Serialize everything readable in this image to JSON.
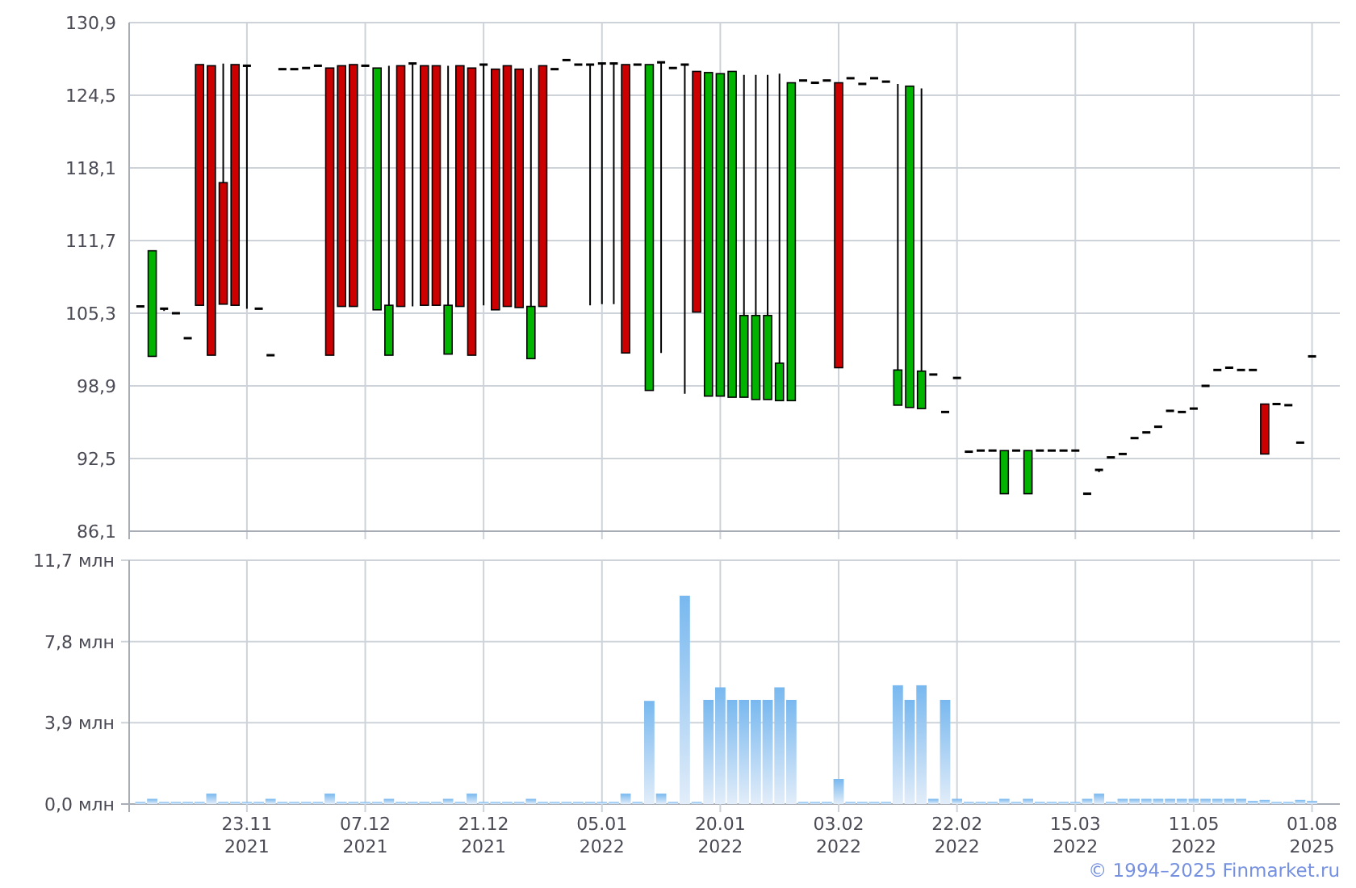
{
  "price_chart": {
    "chart_data": {
      "type": "candlestick",
      "grid": true,
      "categories": [
        null,
        null,
        null,
        null,
        null,
        null,
        null,
        null,
        null,
        null,
        null,
        null,
        null,
        null,
        null,
        null,
        null,
        null,
        null,
        null,
        null,
        null,
        null,
        null,
        null,
        null,
        null,
        null,
        null,
        null,
        null,
        null,
        null,
        null,
        null,
        null,
        null,
        null,
        null,
        null,
        null,
        null,
        null,
        null,
        null,
        null,
        null,
        null,
        null,
        null,
        null,
        null,
        null,
        null,
        null,
        null,
        null,
        null,
        null,
        null,
        null,
        null,
        null,
        null,
        null,
        null,
        null,
        null,
        null,
        null,
        null,
        null,
        null,
        null,
        null,
        null,
        null,
        null,
        null,
        null,
        null,
        null,
        null,
        null,
        null,
        null,
        null,
        null,
        null,
        null,
        null,
        null,
        null,
        null,
        null,
        null,
        null,
        null,
        null,
        null
      ],
      "ylim": [
        86.1,
        130.9
      ],
      "yticks": [
        {
          "value": 86.1,
          "label": "86,1"
        },
        {
          "value": 92.5,
          "label": "92,5"
        },
        {
          "value": 98.9,
          "label": "98,9"
        },
        {
          "value": 105.3,
          "label": "105,3"
        },
        {
          "value": 111.7,
          "label": "111,7"
        },
        {
          "value": 118.1,
          "label": "118,1"
        },
        {
          "value": 124.5,
          "label": "124,5"
        },
        {
          "value": 130.9,
          "label": "130,9"
        }
      ],
      "ohlc": [
        [
          105.9,
          105.9,
          105.9,
          105.9
        ],
        [
          101.5,
          110.8,
          101.5,
          110.8
        ],
        [
          105.5,
          105.7,
          105.5,
          105.7
        ],
        [
          105.3,
          105.3,
          105.3,
          105.3
        ],
        [
          103.1,
          103.1,
          103.1,
          103.1
        ],
        [
          127.2,
          127.2,
          106.0,
          106.0
        ],
        [
          127.1,
          127.1,
          101.6,
          101.6
        ],
        [
          116.8,
          127.3,
          106.1,
          106.1
        ],
        [
          127.2,
          127.2,
          106.0,
          106.0
        ],
        [
          127.1,
          127.1,
          105.7,
          127.1
        ],
        [
          105.7,
          105.7,
          105.7,
          105.7
        ],
        [
          101.6,
          101.6,
          101.6,
          101.6
        ],
        [
          126.8,
          126.8,
          126.8,
          126.8
        ],
        [
          126.8,
          126.8,
          126.8,
          126.8
        ],
        [
          126.9,
          126.9,
          126.9,
          126.9
        ],
        [
          127.1,
          127.1,
          127.1,
          127.1
        ],
        [
          126.9,
          126.9,
          101.6,
          101.6
        ],
        [
          127.1,
          127.1,
          105.9,
          105.9
        ],
        [
          127.2,
          127.2,
          105.9,
          105.9
        ],
        [
          127.1,
          127.1,
          127.1,
          127.1
        ],
        [
          105.6,
          126.9,
          105.6,
          126.9
        ],
        [
          101.6,
          127.1,
          101.6,
          106.0
        ],
        [
          127.1,
          127.1,
          105.9,
          105.9
        ],
        [
          127.3,
          127.3,
          105.9,
          127.3
        ],
        [
          127.1,
          127.1,
          106.0,
          106.0
        ],
        [
          127.1,
          127.1,
          106.0,
          106.0
        ],
        [
          101.7,
          127.1,
          101.7,
          106.0
        ],
        [
          127.1,
          127.1,
          105.9,
          105.9
        ],
        [
          126.9,
          126.9,
          101.6,
          101.6
        ],
        [
          127.2,
          127.2,
          106.0,
          127.2
        ],
        [
          126.8,
          126.8,
          105.6,
          105.6
        ],
        [
          127.1,
          127.1,
          105.9,
          105.9
        ],
        [
          126.8,
          126.8,
          105.8,
          105.8
        ],
        [
          101.3,
          126.9,
          101.3,
          105.9
        ],
        [
          127.1,
          127.1,
          105.9,
          105.9
        ],
        [
          126.8,
          126.8,
          126.8,
          126.8
        ],
        [
          127.6,
          127.6,
          127.6,
          127.6
        ],
        [
          127.2,
          127.2,
          127.2,
          127.2
        ],
        [
          127.2,
          127.2,
          106.0,
          127.2
        ],
        [
          127.3,
          127.3,
          106.1,
          127.3
        ],
        [
          127.3,
          127.3,
          106.1,
          127.3
        ],
        [
          127.2,
          127.2,
          101.8,
          101.8
        ],
        [
          127.2,
          127.2,
          127.2,
          127.2
        ],
        [
          98.5,
          127.2,
          98.5,
          127.2
        ],
        [
          127.4,
          127.4,
          101.8,
          127.4
        ],
        [
          126.9,
          126.9,
          126.9,
          126.9
        ],
        [
          127.0,
          127.2,
          98.2,
          127.2
        ],
        [
          126.6,
          126.6,
          105.4,
          105.4
        ],
        [
          98.0,
          126.5,
          98.0,
          126.5
        ],
        [
          98.0,
          126.4,
          98.0,
          126.4
        ],
        [
          97.9,
          126.6,
          97.9,
          126.6
        ],
        [
          97.9,
          126.3,
          97.9,
          105.1
        ],
        [
          97.7,
          126.3,
          97.7,
          105.1
        ],
        [
          97.7,
          126.3,
          97.7,
          105.1
        ],
        [
          97.6,
          126.4,
          97.6,
          100.9
        ],
        [
          97.6,
          125.6,
          97.6,
          125.6
        ],
        [
          125.8,
          125.8,
          125.8,
          125.8
        ],
        [
          125.6,
          125.6,
          125.6,
          125.6
        ],
        [
          125.8,
          125.8,
          125.8,
          125.8
        ],
        [
          125.6,
          125.6,
          100.5,
          100.5
        ],
        [
          126.0,
          126.0,
          126.0,
          126.0
        ],
        [
          125.5,
          125.5,
          125.5,
          125.5
        ],
        [
          126.0,
          126.0,
          126.0,
          126.0
        ],
        [
          125.7,
          125.7,
          125.7,
          125.7
        ],
        [
          97.2,
          125.5,
          97.2,
          100.3
        ],
        [
          97.0,
          125.3,
          97.0,
          125.3
        ],
        [
          96.9,
          125.1,
          96.9,
          100.2
        ],
        [
          99.9,
          99.9,
          99.9,
          99.9
        ],
        [
          96.6,
          96.6,
          96.6,
          96.6
        ],
        [
          99.6,
          99.6,
          99.6,
          99.6
        ],
        [
          93.1,
          93.1,
          93.1,
          93.1
        ],
        [
          93.2,
          93.2,
          93.2,
          93.2
        ],
        [
          93.2,
          93.2,
          93.2,
          93.2
        ],
        [
          89.4,
          93.2,
          89.4,
          93.2
        ],
        [
          93.2,
          93.2,
          93.2,
          93.2
        ],
        [
          89.4,
          93.2,
          89.4,
          93.2
        ],
        [
          93.2,
          93.2,
          93.2,
          93.2
        ],
        [
          93.2,
          93.2,
          93.2,
          93.2
        ],
        [
          93.2,
          93.2,
          93.2,
          93.2
        ],
        [
          93.2,
          93.2,
          93.2,
          93.2
        ],
        [
          89.4,
          89.4,
          89.4,
          89.4
        ],
        [
          91.3,
          91.5,
          91.3,
          91.5
        ],
        [
          92.6,
          92.6,
          92.6,
          92.6
        ],
        [
          92.9,
          92.9,
          92.9,
          92.9
        ],
        [
          94.3,
          94.3,
          94.3,
          94.3
        ],
        [
          94.8,
          94.8,
          94.8,
          94.8
        ],
        [
          95.3,
          95.3,
          95.3,
          95.3
        ],
        [
          96.7,
          96.7,
          96.7,
          96.7
        ],
        [
          96.6,
          96.6,
          96.6,
          96.6
        ],
        [
          96.9,
          96.9,
          96.9,
          96.9
        ],
        [
          98.9,
          98.9,
          98.9,
          98.9
        ],
        [
          100.3,
          100.3,
          100.3,
          100.3
        ],
        [
          100.5,
          100.5,
          100.5,
          100.5
        ],
        [
          100.3,
          100.3,
          100.3,
          100.3
        ],
        [
          100.3,
          100.3,
          100.3,
          100.3
        ],
        [
          97.3,
          97.3,
          92.9,
          92.9
        ],
        [
          97.3,
          97.3,
          97.3,
          97.3
        ],
        [
          97.2,
          97.2,
          97.2,
          97.2
        ],
        [
          93.9,
          93.9,
          93.9,
          93.9
        ],
        [
          101.5,
          101.5,
          101.5,
          101.5
        ]
      ]
    }
  },
  "volume_chart": {
    "chart_data": {
      "type": "bar",
      "grid": true,
      "ylim": [
        0,
        11.7
      ],
      "yticks": [
        {
          "value": 0,
          "label": "0,0 млн"
        },
        {
          "value": 3.9,
          "label": "3,9 млн"
        },
        {
          "value": 7.8,
          "label": "7,8 млн"
        },
        {
          "value": 11.7,
          "label": "11,7 млн"
        }
      ],
      "categories": [
        null,
        null,
        null,
        null,
        null,
        null,
        null,
        null,
        null,
        "23.11 2021",
        null,
        null,
        null,
        null,
        null,
        null,
        null,
        null,
        null,
        "07.12 2021",
        null,
        null,
        null,
        null,
        null,
        null,
        null,
        null,
        null,
        "21.12 2021",
        null,
        null,
        null,
        null,
        null,
        null,
        null,
        null,
        null,
        "05.01 2022",
        null,
        null,
        null,
        null,
        null,
        null,
        null,
        null,
        null,
        "20.01 2022",
        null,
        null,
        null,
        null,
        null,
        null,
        null,
        null,
        null,
        "03.02 2022",
        null,
        null,
        null,
        null,
        null,
        null,
        null,
        null,
        null,
        "22.02 2022",
        null,
        null,
        null,
        null,
        null,
        null,
        null,
        null,
        null,
        "15.03 2022",
        null,
        null,
        null,
        null,
        null,
        null,
        null,
        null,
        null,
        "11.05 2022",
        null,
        null,
        null,
        null,
        null,
        null,
        null,
        null,
        null,
        "01.08 2025"
      ],
      "series": [
        {
          "color": "#78b8ef",
          "values": [
            0.1,
            0.25,
            0.1,
            0.1,
            0.1,
            0.1,
            0.5,
            0.1,
            0.1,
            0.1,
            0.1,
            0.25,
            0.1,
            0.1,
            0.1,
            0.1,
            0.5,
            0.1,
            0.1,
            0.1,
            0.1,
            0.25,
            0.1,
            0.1,
            0.1,
            0.1,
            0.25,
            0.1,
            0.5,
            0.1,
            0.1,
            0.1,
            0.1,
            0.25,
            0.1,
            0.1,
            0.1,
            0.1,
            0.1,
            0.1,
            0.1,
            0.5,
            0.1,
            4.95,
            0.5,
            0.1,
            10.0,
            0.1,
            5.0,
            5.6,
            5.0,
            5.0,
            5.0,
            5.0,
            5.6,
            5.0,
            0.1,
            0.1,
            0.1,
            1.2,
            0.1,
            0.1,
            0.1,
            0.1,
            5.7,
            5.0,
            5.7,
            0.25,
            5.0,
            0.25,
            0.1,
            0.1,
            0.1,
            0.25,
            0.1,
            0.25,
            0.1,
            0.1,
            0.1,
            0.1,
            0.25,
            0.5,
            0.1,
            0.25,
            0.25,
            0.25,
            0.25,
            0.25,
            0.25,
            0.25,
            0.25,
            0.25,
            0.25,
            0.25,
            0.15,
            0.2,
            0.1,
            0.1,
            0.2,
            0.15
          ]
        }
      ]
    }
  },
  "credit": "© 1994–2025 Finmarket.ru"
}
